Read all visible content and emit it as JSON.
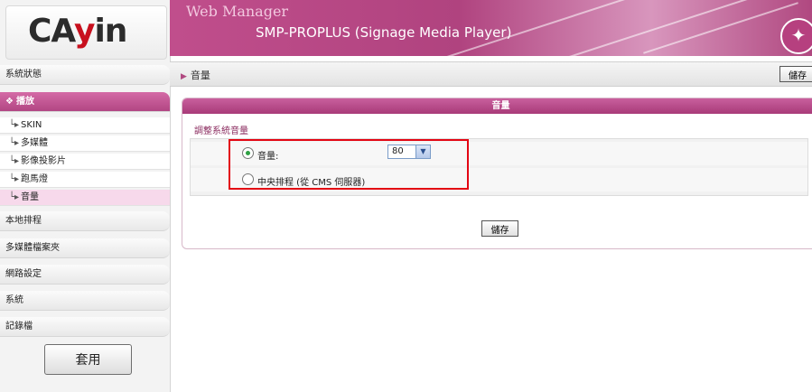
{
  "logo": {
    "text_left": "CA",
    "text_mid": "y",
    "text_right": "in"
  },
  "header": {
    "title": "Web Manager",
    "product": "SMP-PROPLUS (Signage Media Player)",
    "badge_icon": "star-wand-icon"
  },
  "sidebar": {
    "status": "系統狀態",
    "playback": "播放",
    "playback_mark": "❖",
    "sub_items": [
      "SKIN",
      "多媒體",
      "影像投影片",
      "跑馬燈",
      "音量"
    ],
    "sub_arrow": "└▸",
    "schedule": "本地排程",
    "media_folder": "多媒體檔案夾",
    "network": "網路設定",
    "system": "系統",
    "log": "記錄檔",
    "apply": "套用"
  },
  "breadcrumb": {
    "arrow": "▶",
    "label": "音量",
    "save": "儲存"
  },
  "panel": {
    "title": "音量",
    "section_label": "調整系統音量",
    "volume_label": "音量:",
    "volume_value": "80",
    "central_label": "中央排程 (從 CMS 伺服器)",
    "save": "儲存",
    "selected_option": "volume"
  },
  "colors": {
    "accent": "#b5458a",
    "highlight": "#e30613"
  }
}
